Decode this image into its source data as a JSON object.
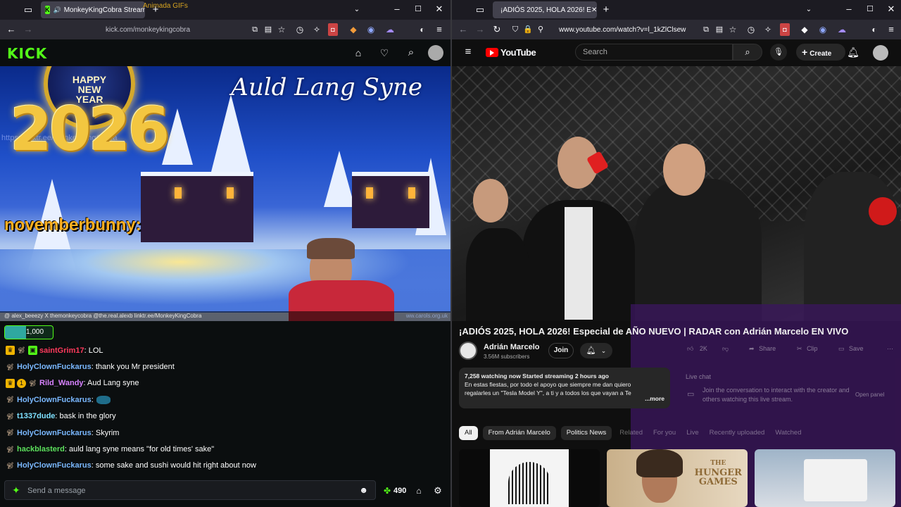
{
  "left_window": {
    "tab_title": "MonkeyKingCobra Stream",
    "gifs_label": "Animada GIFs",
    "address": "kick.com/monkeykingcobra",
    "video": {
      "song_title": "Auld Lang Syne",
      "clock_text_1": "HAPPY",
      "clock_text_2": "NEW",
      "clock_text_3": "YEAR",
      "year": "2026",
      "overlay_url": "https://linktr.ee/MonkeyKingCobra",
      "tts_user": "novemberbunny:",
      "socials": "@ alex_beeezy   X themonkeycobra   @the.real.alexb   linktr.ee/MonkeyKingCobra",
      "watermark": "ww.carols.org.uk"
    },
    "goal_value": "1,000",
    "chat": [
      {
        "user": "saintGrim17",
        "text": ": LOL",
        "color": "#ff3a5c",
        "badges": [
          "crown",
          "sub",
          "gift"
        ]
      },
      {
        "user": "HolyClownFuckarus",
        "text": ": thank you Mr president",
        "color": "#7ab8ff",
        "badges": [
          "sub"
        ]
      },
      {
        "user": "Rild_Wandy",
        "text": ": Aud Lang syne",
        "color": "#d782ff",
        "badges": [
          "crown",
          "one",
          "sub"
        ]
      },
      {
        "user": "HolyClownFuckarus",
        "text": ":",
        "color": "#7ab8ff",
        "badges": [
          "sub"
        ],
        "emote": true
      },
      {
        "user": "t1337dude",
        "text": ": bask in the glory",
        "color": "#7ee0ff",
        "badges": [
          "sub"
        ]
      },
      {
        "user": "HolyClownFuckarus",
        "text": ": Skyrim",
        "color": "#7ab8ff",
        "badges": [
          "sub"
        ]
      },
      {
        "user": "hackblasterd",
        "text": ": auld lang syne means \"for old times' sake\"",
        "color": "#5ce05c",
        "badges": [
          "sub"
        ]
      },
      {
        "user": "HolyClownFuckarus",
        "text": ": some sake and sushi would hit right about now",
        "color": "#7ab8ff",
        "badges": [
          "sub"
        ]
      }
    ],
    "chat_placeholder": "Send a message",
    "points": "490"
  },
  "right_window": {
    "tab_title": "¡ADIÓS 2025, HOLA 2026! E",
    "address": "www.youtube.com/watch?v=l_1kZlClsew",
    "brand": "YouTube",
    "search_placeholder": "Search",
    "create_label": "Create",
    "video_title": "¡ADIÓS 2025, HOLA 2026! Especial de AÑO NUEVO | RADAR con Adrián Marcelo EN VIVO",
    "channel_name": "Adrián Marcelo",
    "subscribers": "3.56M subscribers",
    "join_label": "Join",
    "likes": "2K",
    "share_label": "Share",
    "clip_label": "Clip",
    "save_label": "Save",
    "desc_meta": "7,258 watching now  Started streaming 2 hours ago",
    "desc_line1": "En estas fiestas, por todo el apoyo que siempre me dan quiero",
    "desc_line2": "regalarles un \"Tesla Model Y\", a ti y a todos los que vayan a Te",
    "desc_more": "...more",
    "live_chat_label": "Live chat",
    "live_chat_msg": "Join the conversation to interact with the creator and others watching this live stream.",
    "open_panel": "Open panel",
    "chips": [
      "All",
      "From Adrián Marcelo",
      "Politics News",
      "Related",
      "For you",
      "Live",
      "Recently uploaded",
      "Watched"
    ],
    "thumb3_line1": "THE",
    "thumb3_line2": "HUNGER",
    "thumb3_line3": "GAMES"
  }
}
